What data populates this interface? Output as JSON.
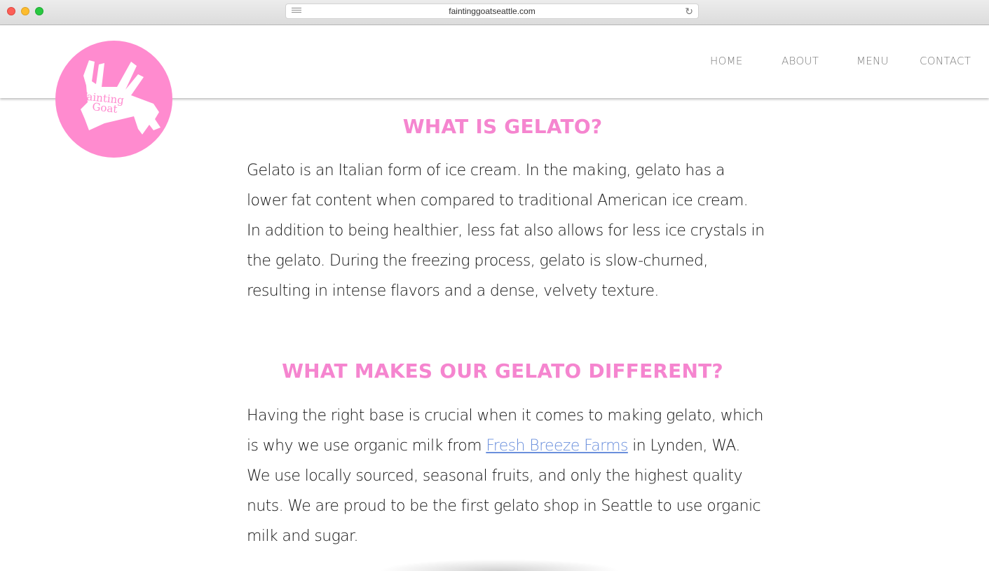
{
  "browser": {
    "url": "faintinggoatseattle.com"
  },
  "logo": {
    "text_line1": "Fainting",
    "text_line2": "Goat",
    "icon": "goat-logo-icon"
  },
  "nav": {
    "home": "HOME",
    "about": "ABOUT",
    "menu": "MENU",
    "contact": "CONTACT"
  },
  "sections": [
    {
      "title": "WHAT IS GELATO?",
      "body": "Gelato is an Italian form of ice cream. In the making, gelato has a lower fat content when compared to traditional American ice cream. In addition to being healthier, less fat also allows for less ice crystals in the gelato. During the freezing process, gelato is slow-churned, resulting in intense flavors and a dense, velvety texture."
    },
    {
      "title": "WHAT MAKES OUR GELATO DIFFERENT?",
      "body_before_link": "Having the right base is crucial when it comes to making gelato, which is why we use organic milk from ",
      "link_text": "Fresh Breeze Farms",
      "body_after_link": " in Lynden, WA. We use locally sourced, seasonal fruits, and only the highest quality nuts. We are proud to be the first gelato shop in Seattle to use organic milk and sugar."
    }
  ],
  "colors": {
    "brand_pink": "#f585cf",
    "link_blue": "#6a8fdc",
    "nav_gray": "#7a7a7a"
  }
}
